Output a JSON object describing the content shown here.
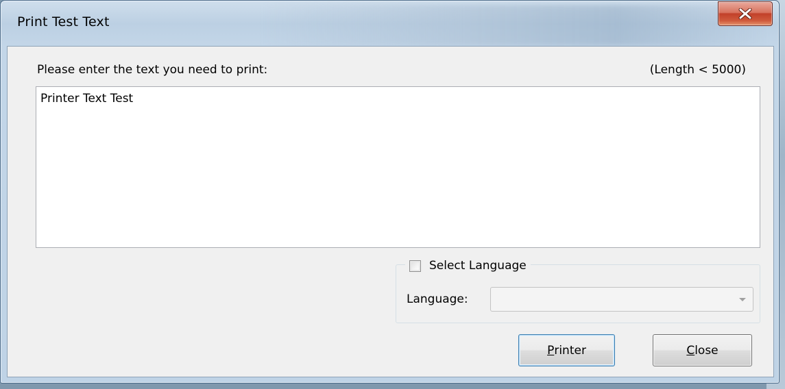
{
  "window": {
    "title": "Print Test Text",
    "close_icon": "close-x-icon",
    "close_button_color": "#c2412a"
  },
  "form": {
    "prompt_label": "Please enter the text you need to print:",
    "length_label": "(Length < 5000)",
    "text_value": "Printer Text Test"
  },
  "language_group": {
    "checkbox_label": "Select Language",
    "checkbox_checked": false,
    "language_label": "Language:",
    "language_value": "",
    "dropdown_icon": "chevron-down-icon",
    "enabled": false
  },
  "buttons": {
    "printer": {
      "first": "P",
      "rest": "rinter"
    },
    "close": {
      "first": "C",
      "rest": "lose"
    }
  },
  "colors": {
    "default_button_border": "#3c7fb1",
    "client_background": "#f0f0f0"
  }
}
